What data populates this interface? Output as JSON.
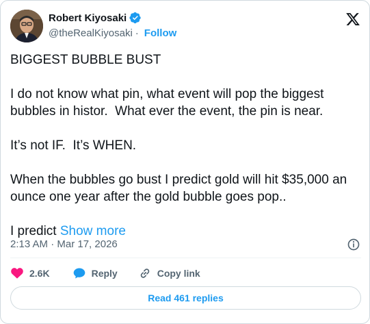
{
  "author": {
    "display_name": "Robert Kiyosaki",
    "handle": "@theRealKiyosaki",
    "separator": "·",
    "follow_label": "Follow",
    "avatar_icon": "avatar-portrait",
    "verified_icon": "verified-badge-icon",
    "verified_color": "#1d9bf0"
  },
  "platform_icon": "x-logo-icon",
  "post": {
    "paragraphs": [
      "BIGGEST BUBBLE BUST",
      "I do not know what pin, what event will pop the biggest bubbles in histor.  What ever the event, the pin is near.",
      "It’s not IF.  It’s WHEN.",
      "When the bubbles go bust I predict gold will hit $35,000 an ounce one year after the gold bubble goes pop..",
      "I predict"
    ],
    "show_more_label": "Show more"
  },
  "meta": {
    "timestamp": "2:13 AM · Mar 17, 2026",
    "info_icon": "info-icon"
  },
  "actions": {
    "like_count": "2.6K",
    "reply_label": "Reply",
    "copy_link_label": "Copy link",
    "like_color": "#f91880",
    "reply_color": "#1d9bf0"
  },
  "footer": {
    "read_replies_label": "Read 461 replies"
  },
  "colors": {
    "accent": "#1d9bf0",
    "text_primary": "#0f1419",
    "text_secondary": "#536471",
    "border": "#cfd9de"
  }
}
